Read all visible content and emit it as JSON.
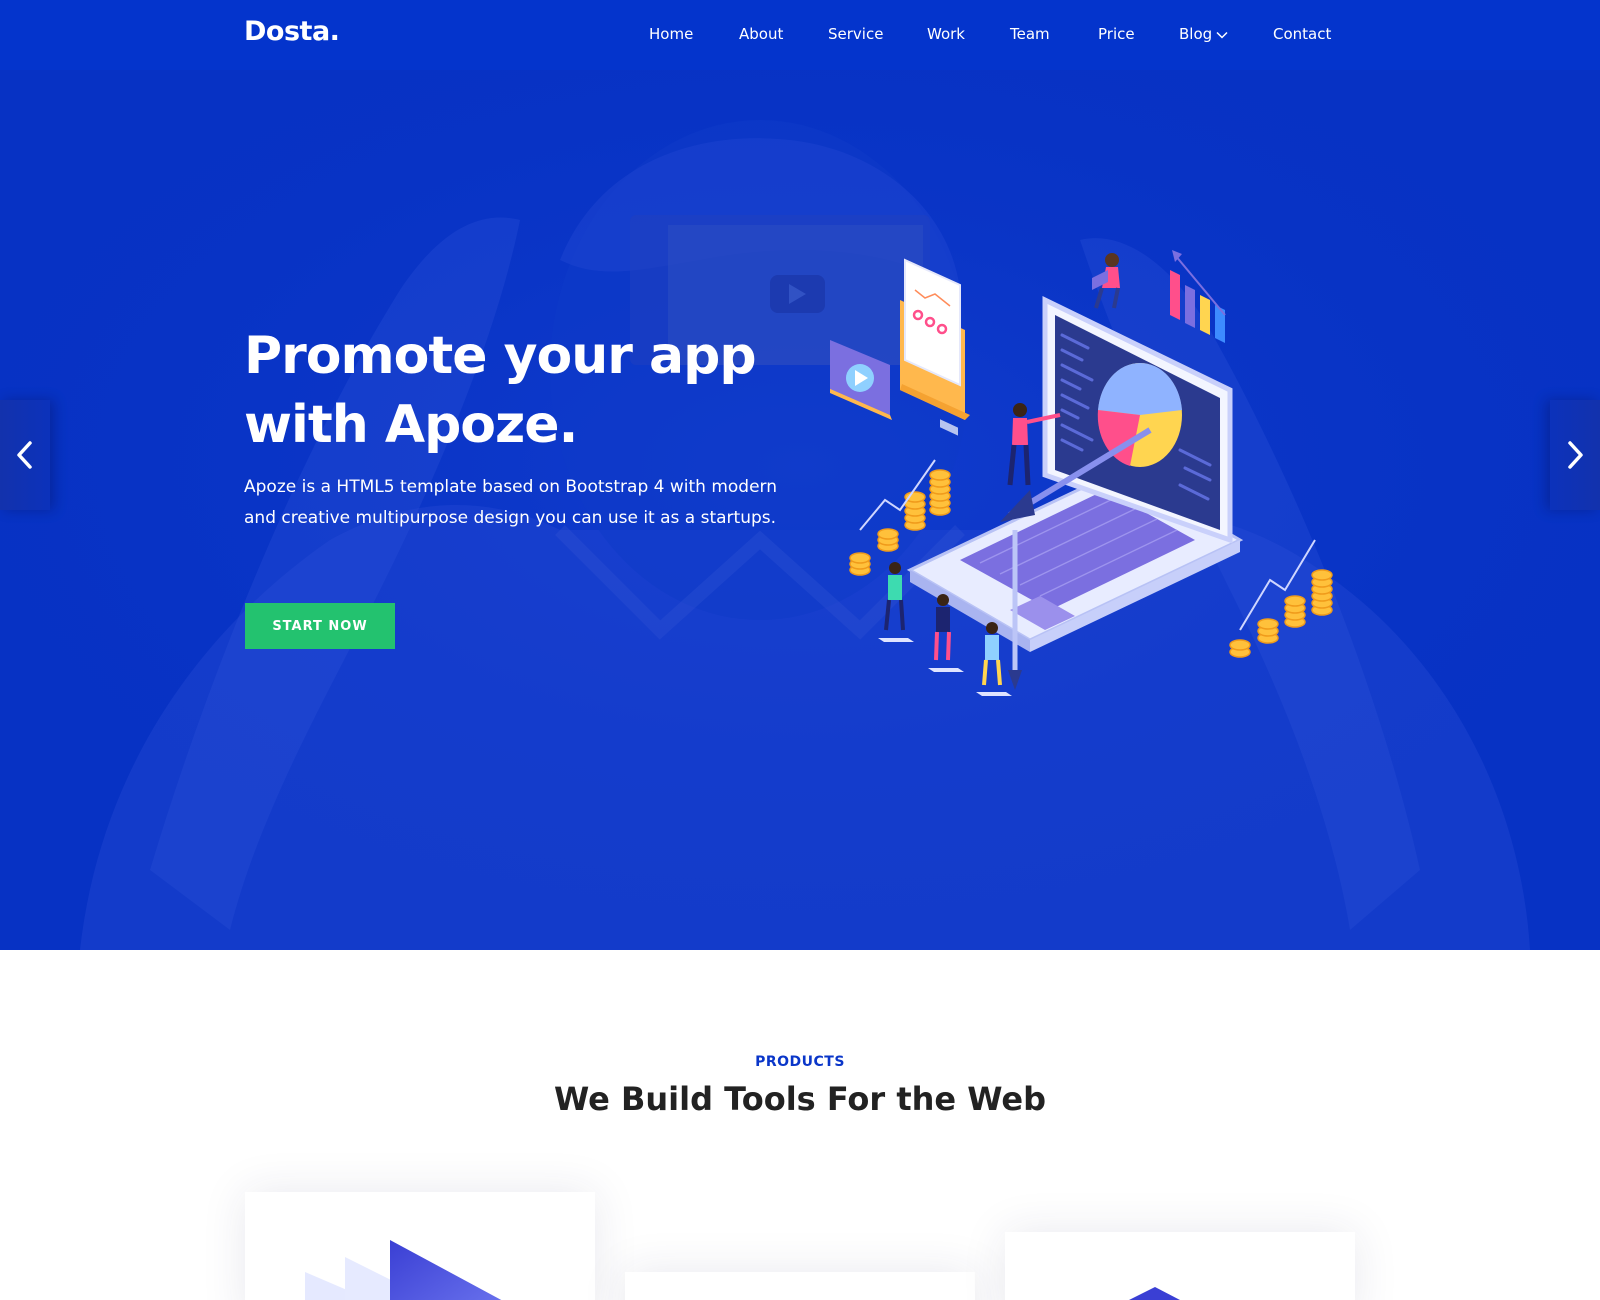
{
  "navbar": {
    "logo": "Dosta.",
    "menu": [
      {
        "label": "Home"
      },
      {
        "label": "About"
      },
      {
        "label": "Service"
      },
      {
        "label": "Work"
      },
      {
        "label": "Team"
      },
      {
        "label": "Price"
      },
      {
        "label": "Blog",
        "has_dropdown": true
      },
      {
        "label": "Contact"
      }
    ]
  },
  "hero": {
    "title_line1": "Promote your app",
    "title_line2": "with Apoze.",
    "description": "Apoze is a HTML5 template based on Bootstrap 4 with modern and creative multipurpose design you can use it as a startups.",
    "cta_label": "START NOW",
    "prev_icon": "chevron-left-icon",
    "next_icon": "chevron-right-icon"
  },
  "products": {
    "label": "PRODUCTS",
    "title": "We Build Tools For the Web"
  },
  "colors": {
    "navbar_bg": "#0434cc",
    "hero_bg": "#0732c4",
    "accent": "#0a36c9",
    "cta": "#23c26f"
  }
}
